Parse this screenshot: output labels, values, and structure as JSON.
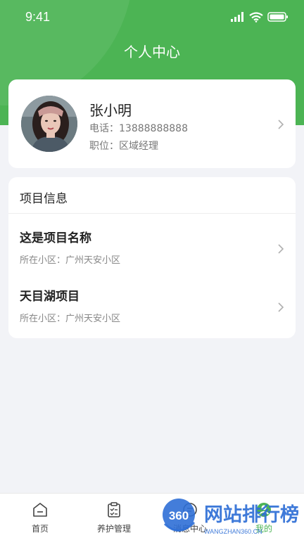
{
  "status_bar": {
    "time": "9:41"
  },
  "header": {
    "title": "个人中心"
  },
  "profile": {
    "name": "张小明",
    "phone": "电话：13888888888",
    "position": "职位：区域经理"
  },
  "project_section": {
    "title": "项目信息",
    "items": [
      {
        "name": "这是项目名称",
        "location": "所在小区：广州天安小区"
      },
      {
        "name": "天目湖项目",
        "location": "所在小区：广州天安小区"
      }
    ]
  },
  "tab_bar": {
    "items": [
      {
        "label": "首页",
        "icon": "home-icon"
      },
      {
        "label": "养护管理",
        "icon": "clipboard-icon"
      },
      {
        "label": "消息中心",
        "icon": "message-icon"
      },
      {
        "label": "我的",
        "icon": "profile-icon"
      }
    ],
    "active_index": 3
  },
  "watermark": {
    "badge": "360",
    "title": "网站排行榜",
    "subtitle": "WANGZHAN360.CN"
  },
  "colors": {
    "accent": "#4cb454",
    "background": "#f2f3f7",
    "card": "#ffffff"
  }
}
